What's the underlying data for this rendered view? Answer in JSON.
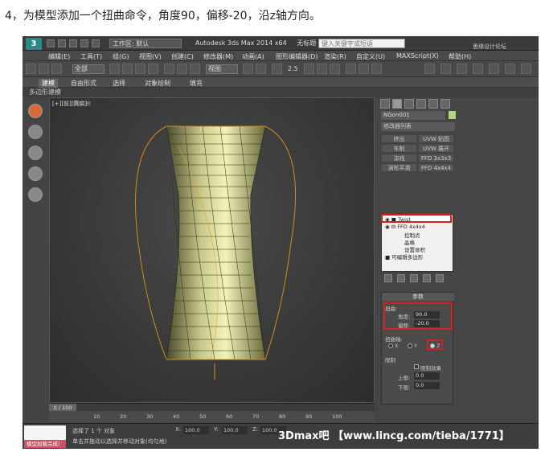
{
  "caption": "4，为模型添加一个扭曲命令，角度90，偏移-20，沿z轴方向。",
  "title": {
    "workspace": "工作区: 默认",
    "app": "Autodesk 3ds Max  2014 x64",
    "file": "无标题",
    "search_placeholder": "键入关键字或短语",
    "watermark_site": "思缘设计论坛 WWW.MISSYUAN.COM",
    "logo": "3"
  },
  "menu": [
    "编辑(E)",
    "工具(T)",
    "组(G)",
    "视图(V)",
    "创建(C)",
    "修改器(M)",
    "动画(A)",
    "图形编辑器(D)",
    "渲染(R)",
    "自定义(U)",
    "MAXScript(X)",
    "帮助(H)"
  ],
  "toolbar": {
    "selection_filter": "全部",
    "view_dropdown": "视图",
    "snap_label": "2.5"
  },
  "ribbon_tabs": [
    "建模",
    "自由形式",
    "选择",
    "对象绘制",
    "填充"
  ],
  "sub_ribbon": "多边形建模",
  "viewport": {
    "label": "[+][前][真实]",
    "label2": "明暗处理"
  },
  "panel": {
    "object_name": "NGon001",
    "modifier_list": "修改器列表",
    "buttons": [
      "挤出",
      "UVW 贴图",
      "车削",
      "UVW 展开",
      "法线",
      "FFD 3x3x3",
      "涡轮平滑",
      "FFD 4x4x4"
    ],
    "stack": [
      "Twist",
      "FFD 4x4x4",
      "控制点",
      "晶格",
      "设置体积",
      "可编辑多边形"
    ],
    "params_title": "参数",
    "twist_group": "扭曲:",
    "angle_label": "角度:",
    "angle_value": "90.0",
    "bias_label": "偏移:",
    "bias_value": "-20.0",
    "axis_group": "扭曲轴:",
    "axes": [
      "X",
      "Y",
      "Z"
    ],
    "limit_group": "限制",
    "limit_effect": "限制效果",
    "upper_label": "上限:",
    "upper_value": "0.0",
    "lower_label": "下限:",
    "lower_value": "0.0"
  },
  "timeline": {
    "frame": "0 / 100",
    "ticks": [
      "0",
      "10",
      "20",
      "30",
      "40",
      "50",
      "60",
      "70",
      "80",
      "90",
      "100"
    ]
  },
  "status": {
    "maxscript": "模型加载完成!",
    "selected": "选择了 1 个 对象",
    "hint": "单击并拖动以选择并移动对象(均匀地)",
    "x_label": "X:",
    "x_value": "100.0",
    "y_label": "Y:",
    "y_value": "100.0",
    "z_label": "Z:",
    "z_value": "100.0",
    "watermark": "3Dmax吧 【www.lincg.com/tieba/1771】"
  }
}
